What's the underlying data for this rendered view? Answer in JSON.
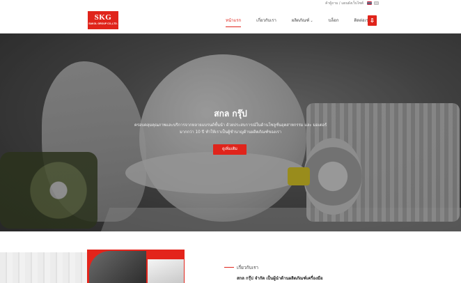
{
  "topbar": {
    "utility_text": "ค้าผู้ถาม / แผนผังเว็บไซต์",
    "flags": [
      "thai-flag-icon",
      "english-flag-icon"
    ]
  },
  "header": {
    "logo_text": "SKG",
    "logo_sub": "SAKOL GROUP CO.,LTD.",
    "nav": [
      {
        "label": "หน้าแรก",
        "active": true
      },
      {
        "label": "เกี่ยวกับเรา",
        "active": false
      },
      {
        "label": "ผลิตภัณฑ์",
        "active": false,
        "has_dropdown": true
      },
      {
        "label": "บล็อก",
        "active": false
      },
      {
        "label": "ติดต่อเรา",
        "active": false
      }
    ],
    "pdf_icon": "pdf-download-icon"
  },
  "hero": {
    "title": "สกล กรุ๊ป",
    "description": "ครอบคลุมคุณภาพและบริการจากหลายแบรนด์ชั้นนำ ด้วยประสบการณ์ในด้านโซลูชั่นอุตสาหกรรม และ มอเตอร์มากกว่า 10 ปี ทำให้เราเป็นผู้ชำนาญด้านผลิตภัณฑ์ของเรา",
    "button_label": "ดูเพิ่มเติม"
  },
  "about": {
    "section_label": "เกี่ยวกับเรา",
    "snippet": "สกล กรุ๊ป จำกัด เป็นผู้นำด้านผลิตภัณฑ์เครื่องมือ"
  },
  "colors": {
    "accent": "#e0241b",
    "text": "#444444",
    "hero_overlay": "#3a3a3a"
  }
}
